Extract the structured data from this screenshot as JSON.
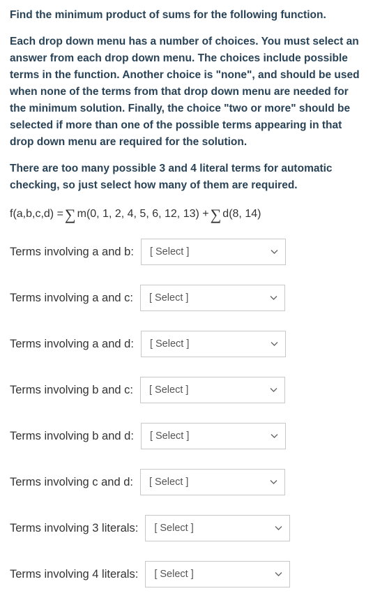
{
  "instructions": {
    "p1": "Find the minimum product of sums for the following function.",
    "p2": "Each drop down menu has a number of choices. You must select an answer from each drop down menu. The choices include possible terms in the function. Another choice is \"none\", and should be used when none of the terms from that drop down menu are needed for the minimum solution. Finally, the choice \"two or more\" should be selected if more than one of the possible terms appearing in that drop down menu are required for the solution.",
    "p3": "There are too many possible 3 and 4 literal terms for automatic checking, so just select how many of them are required."
  },
  "formula": {
    "lhs": "f(a,b,c,d) = ",
    "m_args": "m(0, 1, 2, 4, 5, 6, 12, 13) + ",
    "d_args": "d(8, 14)"
  },
  "select_placeholder": "[ Select ]",
  "rows": [
    {
      "label": "Terms involving a and b:"
    },
    {
      "label": "Terms involving a and c:"
    },
    {
      "label": "Terms involving a and d:"
    },
    {
      "label": "Terms involving b and c:"
    },
    {
      "label": "Terms involving b and d:"
    },
    {
      "label": "Terms involving c and d:"
    },
    {
      "label": "Terms involving 3 literals:"
    },
    {
      "label": "Terms involving 4 literals:"
    }
  ]
}
